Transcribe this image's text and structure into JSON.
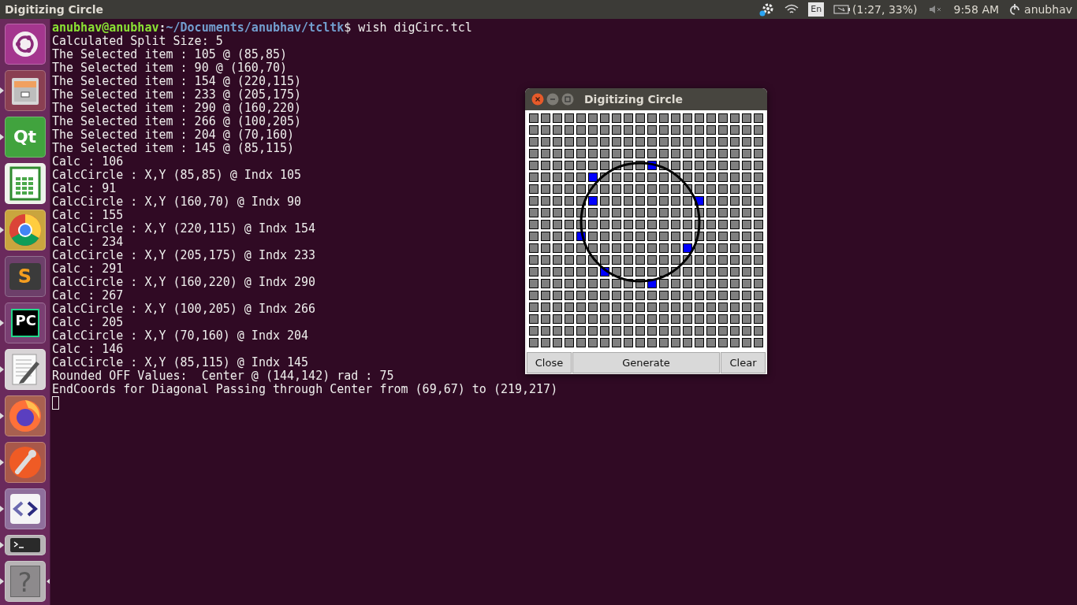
{
  "top_bar": {
    "title": "Digitizing Circle",
    "keyboard": "En",
    "battery": "(1:27, 33%)",
    "time": "9:58 AM",
    "user": "anubhav"
  },
  "launcher": [
    {
      "kind": "ubuntu",
      "running": false,
      "focused": false
    },
    {
      "kind": "files",
      "running": true,
      "focused": false
    },
    {
      "kind": "qt",
      "label": "Qt",
      "running": true,
      "focused": false
    },
    {
      "kind": "calc",
      "running": false,
      "focused": false
    },
    {
      "kind": "chrome",
      "running": true,
      "focused": false
    },
    {
      "kind": "sublime",
      "label": "S",
      "running": false,
      "focused": false
    },
    {
      "kind": "pycharm",
      "label": "PC",
      "running": true,
      "focused": false
    },
    {
      "kind": "editor",
      "running": true,
      "focused": false
    },
    {
      "kind": "firefox",
      "running": true,
      "focused": false
    },
    {
      "kind": "postman",
      "running": true,
      "focused": false
    },
    {
      "kind": "brackets",
      "running": true,
      "focused": false
    },
    {
      "kind": "terminal",
      "running": true,
      "focused": false
    },
    {
      "kind": "help",
      "label": "?",
      "running": true,
      "focused": true
    }
  ],
  "terminal": {
    "prompt": {
      "user": "anubhav@anubhav",
      "separator": ":",
      "path": "~/Documents/anubhav/tcltk",
      "command": "$ wish digCirc.tcl"
    },
    "lines": [
      "Calculated Split Size: 5",
      "The Selected item : 105 @ (85,85)",
      "The Selected item : 90 @ (160,70)",
      "The Selected item : 154 @ (220,115)",
      "The Selected item : 233 @ (205,175)",
      "The Selected item : 290 @ (160,220)",
      "The Selected item : 266 @ (100,205)",
      "The Selected item : 204 @ (70,160)",
      "The Selected item : 145 @ (85,115)",
      "Calc : 106",
      "CalcCircle : X,Y (85,85) @ Indx 105",
      "Calc : 91",
      "CalcCircle : X,Y (160,70) @ Indx 90",
      "Calc : 155",
      "CalcCircle : X,Y (220,115) @ Indx 154",
      "Calc : 234",
      "CalcCircle : X,Y (205,175) @ Indx 233",
      "Calc : 291",
      "CalcCircle : X,Y (160,220) @ Indx 290",
      "Calc : 267",
      "CalcCircle : X,Y (100,205) @ Indx 266",
      "Calc : 205",
      "CalcCircle : X,Y (70,160) @ Indx 204",
      "Calc : 146",
      "CalcCircle : X,Y (85,115) @ Indx 145",
      "Rounded OFF Values:  Center @ (144,142) rad : 75",
      "EndCoords for Diagonal Passing through Center from (69,67) to (219,217)"
    ]
  },
  "dialog": {
    "title": "Digitizing Circle",
    "buttons": [
      "Close",
      "Generate",
      "Clear"
    ],
    "grid": [
      {
        "cells": [
          {
            "selected": false
          },
          {
            "selected": false
          },
          {
            "selected": false
          },
          {
            "selected": false
          },
          {
            "selected": false
          },
          {
            "selected": false
          },
          {
            "selected": false
          },
          {
            "selected": false
          },
          {
            "selected": false
          },
          {
            "selected": false
          },
          {
            "selected": false
          },
          {
            "selected": false
          },
          {
            "selected": false
          },
          {
            "selected": false
          },
          {
            "selected": false
          },
          {
            "selected": false
          },
          {
            "selected": false
          },
          {
            "selected": false
          },
          {
            "selected": false
          },
          {
            "selected": false
          }
        ]
      },
      {
        "cells": [
          {
            "selected": false
          },
          {
            "selected": false
          },
          {
            "selected": false
          },
          {
            "selected": false
          },
          {
            "selected": false
          },
          {
            "selected": false
          },
          {
            "selected": false
          },
          {
            "selected": false
          },
          {
            "selected": false
          },
          {
            "selected": false
          },
          {
            "selected": false
          },
          {
            "selected": false
          },
          {
            "selected": false
          },
          {
            "selected": false
          },
          {
            "selected": false
          },
          {
            "selected": false
          },
          {
            "selected": false
          },
          {
            "selected": false
          },
          {
            "selected": false
          },
          {
            "selected": false
          }
        ]
      },
      {
        "cells": [
          {
            "selected": false
          },
          {
            "selected": false
          },
          {
            "selected": false
          },
          {
            "selected": false
          },
          {
            "selected": false
          },
          {
            "selected": false
          },
          {
            "selected": false
          },
          {
            "selected": false
          },
          {
            "selected": false
          },
          {
            "selected": false
          },
          {
            "selected": false
          },
          {
            "selected": false
          },
          {
            "selected": false
          },
          {
            "selected": false
          },
          {
            "selected": false
          },
          {
            "selected": false
          },
          {
            "selected": false
          },
          {
            "selected": false
          },
          {
            "selected": false
          },
          {
            "selected": false
          }
        ]
      },
      {
        "cells": [
          {
            "selected": false
          },
          {
            "selected": false
          },
          {
            "selected": false
          },
          {
            "selected": false
          },
          {
            "selected": false
          },
          {
            "selected": false
          },
          {
            "selected": false
          },
          {
            "selected": false
          },
          {
            "selected": false
          },
          {
            "selected": false
          },
          {
            "selected": false
          },
          {
            "selected": false
          },
          {
            "selected": false
          },
          {
            "selected": false
          },
          {
            "selected": false
          },
          {
            "selected": false
          },
          {
            "selected": false
          },
          {
            "selected": false
          },
          {
            "selected": false
          },
          {
            "selected": false
          }
        ]
      },
      {
        "cells": [
          {
            "selected": false
          },
          {
            "selected": false
          },
          {
            "selected": false
          },
          {
            "selected": false
          },
          {
            "selected": false
          },
          {
            "selected": false
          },
          {
            "selected": false
          },
          {
            "selected": false
          },
          {
            "selected": false
          },
          {
            "selected": false
          },
          {
            "selected": true
          },
          {
            "selected": false
          },
          {
            "selected": false
          },
          {
            "selected": false
          },
          {
            "selected": false
          },
          {
            "selected": false
          },
          {
            "selected": false
          },
          {
            "selected": false
          },
          {
            "selected": false
          },
          {
            "selected": false
          }
        ]
      },
      {
        "cells": [
          {
            "selected": false
          },
          {
            "selected": false
          },
          {
            "selected": false
          },
          {
            "selected": false
          },
          {
            "selected": false
          },
          {
            "selected": true
          },
          {
            "selected": false
          },
          {
            "selected": false
          },
          {
            "selected": false
          },
          {
            "selected": false
          },
          {
            "selected": false
          },
          {
            "selected": false
          },
          {
            "selected": false
          },
          {
            "selected": false
          },
          {
            "selected": false
          },
          {
            "selected": false
          },
          {
            "selected": false
          },
          {
            "selected": false
          },
          {
            "selected": false
          },
          {
            "selected": false
          }
        ]
      },
      {
        "cells": [
          {
            "selected": false
          },
          {
            "selected": false
          },
          {
            "selected": false
          },
          {
            "selected": false
          },
          {
            "selected": false
          },
          {
            "selected": false
          },
          {
            "selected": false
          },
          {
            "selected": false
          },
          {
            "selected": false
          },
          {
            "selected": false
          },
          {
            "selected": false
          },
          {
            "selected": false
          },
          {
            "selected": false
          },
          {
            "selected": false
          },
          {
            "selected": false
          },
          {
            "selected": false
          },
          {
            "selected": false
          },
          {
            "selected": false
          },
          {
            "selected": false
          },
          {
            "selected": false
          }
        ]
      },
      {
        "cells": [
          {
            "selected": false
          },
          {
            "selected": false
          },
          {
            "selected": false
          },
          {
            "selected": false
          },
          {
            "selected": false
          },
          {
            "selected": true
          },
          {
            "selected": false
          },
          {
            "selected": false
          },
          {
            "selected": false
          },
          {
            "selected": false
          },
          {
            "selected": false
          },
          {
            "selected": false
          },
          {
            "selected": false
          },
          {
            "selected": false
          },
          {
            "selected": true
          },
          {
            "selected": false
          },
          {
            "selected": false
          },
          {
            "selected": false
          },
          {
            "selected": false
          },
          {
            "selected": false
          }
        ]
      },
      {
        "cells": [
          {
            "selected": false
          },
          {
            "selected": false
          },
          {
            "selected": false
          },
          {
            "selected": false
          },
          {
            "selected": false
          },
          {
            "selected": false
          },
          {
            "selected": false
          },
          {
            "selected": false
          },
          {
            "selected": false
          },
          {
            "selected": false
          },
          {
            "selected": false
          },
          {
            "selected": false
          },
          {
            "selected": false
          },
          {
            "selected": false
          },
          {
            "selected": false
          },
          {
            "selected": false
          },
          {
            "selected": false
          },
          {
            "selected": false
          },
          {
            "selected": false
          },
          {
            "selected": false
          }
        ]
      },
      {
        "cells": [
          {
            "selected": false
          },
          {
            "selected": false
          },
          {
            "selected": false
          },
          {
            "selected": false
          },
          {
            "selected": false
          },
          {
            "selected": false
          },
          {
            "selected": false
          },
          {
            "selected": false
          },
          {
            "selected": false
          },
          {
            "selected": false
          },
          {
            "selected": false
          },
          {
            "selected": false
          },
          {
            "selected": false
          },
          {
            "selected": false
          },
          {
            "selected": false
          },
          {
            "selected": false
          },
          {
            "selected": false
          },
          {
            "selected": false
          },
          {
            "selected": false
          },
          {
            "selected": false
          }
        ]
      },
      {
        "cells": [
          {
            "selected": false
          },
          {
            "selected": false
          },
          {
            "selected": false
          },
          {
            "selected": false
          },
          {
            "selected": true
          },
          {
            "selected": false
          },
          {
            "selected": false
          },
          {
            "selected": false
          },
          {
            "selected": false
          },
          {
            "selected": false
          },
          {
            "selected": false
          },
          {
            "selected": false
          },
          {
            "selected": false
          },
          {
            "selected": false
          },
          {
            "selected": false
          },
          {
            "selected": false
          },
          {
            "selected": false
          },
          {
            "selected": false
          },
          {
            "selected": false
          },
          {
            "selected": false
          }
        ]
      },
      {
        "cells": [
          {
            "selected": false
          },
          {
            "selected": false
          },
          {
            "selected": false
          },
          {
            "selected": false
          },
          {
            "selected": false
          },
          {
            "selected": false
          },
          {
            "selected": false
          },
          {
            "selected": false
          },
          {
            "selected": false
          },
          {
            "selected": false
          },
          {
            "selected": false
          },
          {
            "selected": false
          },
          {
            "selected": false
          },
          {
            "selected": true
          },
          {
            "selected": false
          },
          {
            "selected": false
          },
          {
            "selected": false
          },
          {
            "selected": false
          },
          {
            "selected": false
          },
          {
            "selected": false
          }
        ]
      },
      {
        "cells": [
          {
            "selected": false
          },
          {
            "selected": false
          },
          {
            "selected": false
          },
          {
            "selected": false
          },
          {
            "selected": false
          },
          {
            "selected": false
          },
          {
            "selected": false
          },
          {
            "selected": false
          },
          {
            "selected": false
          },
          {
            "selected": false
          },
          {
            "selected": false
          },
          {
            "selected": false
          },
          {
            "selected": false
          },
          {
            "selected": false
          },
          {
            "selected": false
          },
          {
            "selected": false
          },
          {
            "selected": false
          },
          {
            "selected": false
          },
          {
            "selected": false
          },
          {
            "selected": false
          }
        ]
      },
      {
        "cells": [
          {
            "selected": false
          },
          {
            "selected": false
          },
          {
            "selected": false
          },
          {
            "selected": false
          },
          {
            "selected": false
          },
          {
            "selected": false
          },
          {
            "selected": true
          },
          {
            "selected": false
          },
          {
            "selected": false
          },
          {
            "selected": false
          },
          {
            "selected": false
          },
          {
            "selected": false
          },
          {
            "selected": false
          },
          {
            "selected": false
          },
          {
            "selected": false
          },
          {
            "selected": false
          },
          {
            "selected": false
          },
          {
            "selected": false
          },
          {
            "selected": false
          },
          {
            "selected": false
          }
        ]
      },
      {
        "cells": [
          {
            "selected": false
          },
          {
            "selected": false
          },
          {
            "selected": false
          },
          {
            "selected": false
          },
          {
            "selected": false
          },
          {
            "selected": false
          },
          {
            "selected": false
          },
          {
            "selected": false
          },
          {
            "selected": false
          },
          {
            "selected": false
          },
          {
            "selected": true
          },
          {
            "selected": false
          },
          {
            "selected": false
          },
          {
            "selected": false
          },
          {
            "selected": false
          },
          {
            "selected": false
          },
          {
            "selected": false
          },
          {
            "selected": false
          },
          {
            "selected": false
          },
          {
            "selected": false
          }
        ]
      },
      {
        "cells": [
          {
            "selected": false
          },
          {
            "selected": false
          },
          {
            "selected": false
          },
          {
            "selected": false
          },
          {
            "selected": false
          },
          {
            "selected": false
          },
          {
            "selected": false
          },
          {
            "selected": false
          },
          {
            "selected": false
          },
          {
            "selected": false
          },
          {
            "selected": false
          },
          {
            "selected": false
          },
          {
            "selected": false
          },
          {
            "selected": false
          },
          {
            "selected": false
          },
          {
            "selected": false
          },
          {
            "selected": false
          },
          {
            "selected": false
          },
          {
            "selected": false
          },
          {
            "selected": false
          }
        ]
      },
      {
        "cells": [
          {
            "selected": false
          },
          {
            "selected": false
          },
          {
            "selected": false
          },
          {
            "selected": false
          },
          {
            "selected": false
          },
          {
            "selected": false
          },
          {
            "selected": false
          },
          {
            "selected": false
          },
          {
            "selected": false
          },
          {
            "selected": false
          },
          {
            "selected": false
          },
          {
            "selected": false
          },
          {
            "selected": false
          },
          {
            "selected": false
          },
          {
            "selected": false
          },
          {
            "selected": false
          },
          {
            "selected": false
          },
          {
            "selected": false
          },
          {
            "selected": false
          },
          {
            "selected": false
          }
        ]
      },
      {
        "cells": [
          {
            "selected": false
          },
          {
            "selected": false
          },
          {
            "selected": false
          },
          {
            "selected": false
          },
          {
            "selected": false
          },
          {
            "selected": false
          },
          {
            "selected": false
          },
          {
            "selected": false
          },
          {
            "selected": false
          },
          {
            "selected": false
          },
          {
            "selected": false
          },
          {
            "selected": false
          },
          {
            "selected": false
          },
          {
            "selected": false
          },
          {
            "selected": false
          },
          {
            "selected": false
          },
          {
            "selected": false
          },
          {
            "selected": false
          },
          {
            "selected": false
          },
          {
            "selected": false
          }
        ]
      },
      {
        "cells": [
          {
            "selected": false
          },
          {
            "selected": false
          },
          {
            "selected": false
          },
          {
            "selected": false
          },
          {
            "selected": false
          },
          {
            "selected": false
          },
          {
            "selected": false
          },
          {
            "selected": false
          },
          {
            "selected": false
          },
          {
            "selected": false
          },
          {
            "selected": false
          },
          {
            "selected": false
          },
          {
            "selected": false
          },
          {
            "selected": false
          },
          {
            "selected": false
          },
          {
            "selected": false
          },
          {
            "selected": false
          },
          {
            "selected": false
          },
          {
            "selected": false
          },
          {
            "selected": false
          }
        ]
      },
      {
        "cells": [
          {
            "selected": false
          },
          {
            "selected": false
          },
          {
            "selected": false
          },
          {
            "selected": false
          },
          {
            "selected": false
          },
          {
            "selected": false
          },
          {
            "selected": false
          },
          {
            "selected": false
          },
          {
            "selected": false
          },
          {
            "selected": false
          },
          {
            "selected": false
          },
          {
            "selected": false
          },
          {
            "selected": false
          },
          {
            "selected": false
          },
          {
            "selected": false
          },
          {
            "selected": false
          },
          {
            "selected": false
          },
          {
            "selected": false
          },
          {
            "selected": false
          },
          {
            "selected": false
          }
        ]
      }
    ]
  }
}
